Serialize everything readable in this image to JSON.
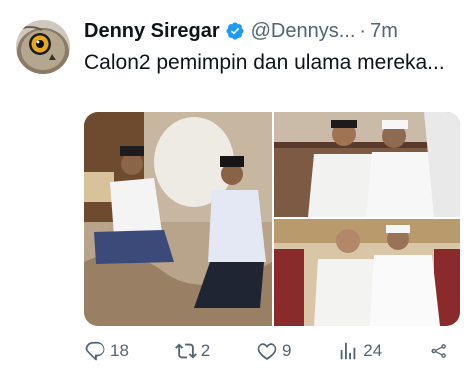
{
  "author": {
    "display_name": "Denny Siregar",
    "handle": "@Dennys...",
    "separator": "·",
    "time": "7m",
    "verified_icon": "verified-badge-icon",
    "avatar_icon": "owl-avatar"
  },
  "tweet": {
    "text": "Calon2 pemimpin dan ulama mereka..."
  },
  "media": {
    "count": 3
  },
  "actions": {
    "reply_count": "18",
    "retweet_count": "2",
    "like_count": "9",
    "views_count": "24"
  },
  "colors": {
    "text": "#0f1419",
    "secondary": "#536471",
    "verified": "#1d9bf0"
  }
}
